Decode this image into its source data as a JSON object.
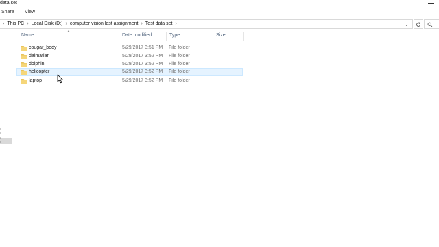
{
  "window": {
    "title": "data set"
  },
  "ribbon": {
    "tabs": [
      "Share",
      "View"
    ]
  },
  "address": {
    "crumbs": [
      "This PC",
      "Local Disk (D:)",
      "computer vision last assignment",
      "Test data set"
    ]
  },
  "nav": {
    "fragments": [
      ")",
      ")"
    ]
  },
  "columns": {
    "name": "Name",
    "date_modified": "Date modified",
    "type": "Type",
    "size": "Size"
  },
  "files": [
    {
      "name": "cougar_body",
      "date": "5/29/2017 3:51 PM",
      "type": "File folder"
    },
    {
      "name": "dalmatian",
      "date": "5/29/2017 3:52 PM",
      "type": "File folder"
    },
    {
      "name": "dolphin",
      "date": "5/29/2017 3:52 PM",
      "type": "File folder"
    },
    {
      "name": "helicopter",
      "date": "5/29/2017 3:52 PM",
      "type": "File folder",
      "hovered": true
    },
    {
      "name": "laptop",
      "date": "5/29/2017 3:52 PM",
      "type": "File folder"
    }
  ],
  "colors": {
    "folder": "#e8c35a",
    "hover_bg": "#e5f3ff",
    "header_text": "#4c607a"
  }
}
